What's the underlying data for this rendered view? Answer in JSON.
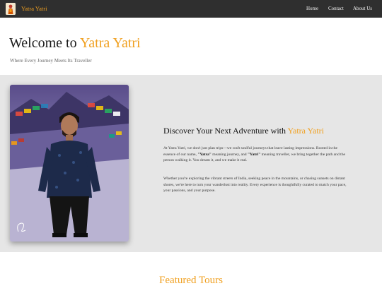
{
  "navbar": {
    "brand": "Yatra Yatri",
    "links": [
      "Home",
      "Contact",
      "About Us"
    ]
  },
  "hero": {
    "title_prefix": "Welcome to ",
    "title_accent": "Yatra Yatri",
    "subtitle": "Where Every Journey Meets Its Traveller"
  },
  "about": {
    "heading_prefix": "Discover Your Next Adventure with ",
    "heading_accent": "Yatra Yatri",
    "p1_a": "At Yatra Yatri, we don't just plan trips—we craft soulful journeys that leave lasting impressions. Rooted in the essence of our name, ",
    "p1_yatra": "\"Yatra\"",
    "p1_b": " meaning journey, and ",
    "p1_yatri": "\"Yatri\"",
    "p1_c": " meaning traveller, we bring together the path and the person walking it. You dream it, and we make it real.",
    "p2": "Whether you're exploring the vibrant streets of India, seeking peace in the mountains, or chasing sunsets on distant shores, we're here to turn your wanderlust into reality. Every experience is thoughtfully curated to match your pace, your passions, and your purpose."
  },
  "featured": {
    "title": "Featured Tours"
  },
  "colors": {
    "accent": "#f0a020",
    "navbar_bg": "#2f2f2f",
    "section_bg": "#e6e6e6"
  }
}
